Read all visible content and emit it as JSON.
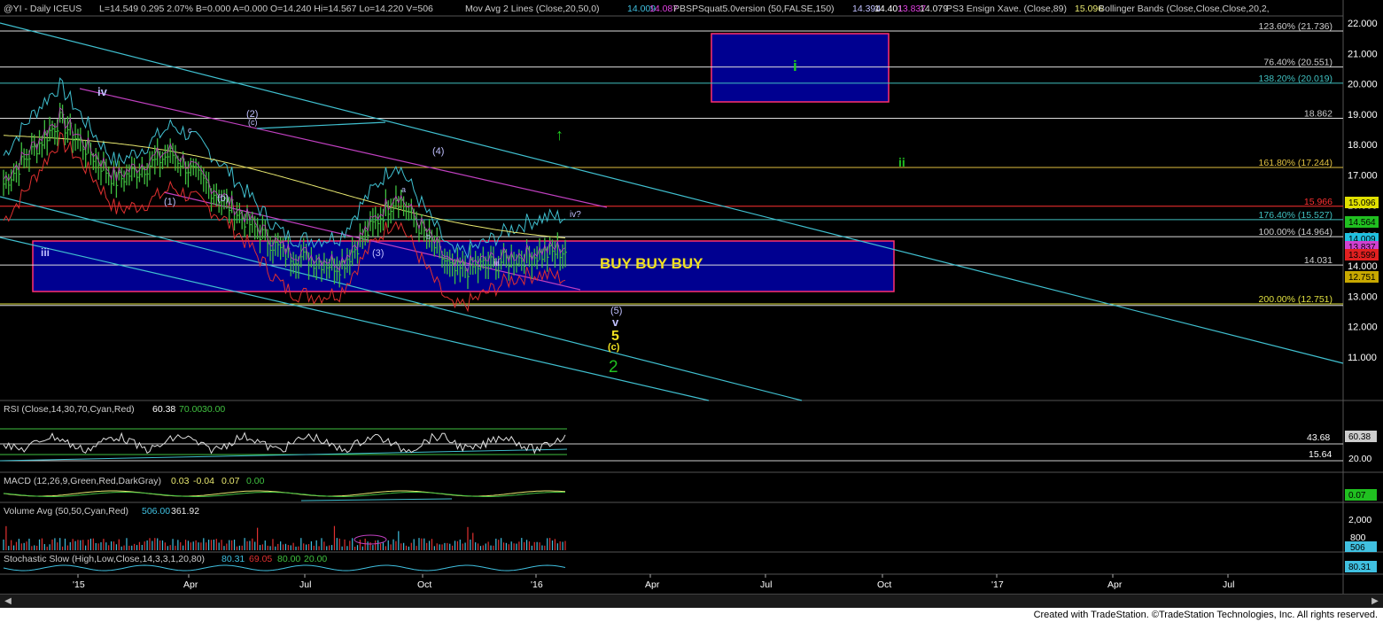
{
  "header": {
    "symbol": "@YI - Daily  ICEUS",
    "quote": "L=14.549  0.295  2.07%  B=0.000   A=0.000   O=14.240  Hi=14.567  Lo=14.220  V=506",
    "ma_label": "Mov Avg 2 Lines (Close,20,50,0)",
    "ma_vals": [
      "14.009",
      "14.087"
    ],
    "squat_label": "PBSPSquat5.0version (50,FALSE,150)",
    "squat_vals": [
      "14.394",
      "14.401",
      "13.837",
      "14.079"
    ],
    "ens_label": "PS3 Ensign Xave. (Close,89)",
    "ens_val": "15.096",
    "bb_label": "Bollinger Bands (Close,Close,Close,20,2,"
  },
  "price_axis": [
    "22.000",
    "21.000",
    "20.000",
    "19.000",
    "18.000",
    "17.000",
    "16.000",
    "15.000",
    "14.000",
    "13.000",
    "12.000",
    "11.000"
  ],
  "price_levels": [
    {
      "label": "123.60% (21.736)",
      "value": 21.736,
      "color": "#cccccc"
    },
    {
      "label": "76.40% (20.551)",
      "value": 20.551,
      "color": "#cccccc"
    },
    {
      "label": "138.20% (20.019)",
      "value": 20.019,
      "color": "#40c0c0"
    },
    {
      "label": "18.862",
      "value": 18.862,
      "color": "#cccccc"
    },
    {
      "label": "161.80% (17.244)",
      "value": 17.244,
      "color": "#e0c040"
    },
    {
      "label": "15.966",
      "value": 15.966,
      "color": "#ff3030"
    },
    {
      "label": "176.40% (15.527)",
      "value": 15.527,
      "color": "#40c0c0"
    },
    {
      "label": "100.00% (14.964)",
      "value": 14.964,
      "color": "#cccccc"
    },
    {
      "label": "14.031",
      "value": 14.031,
      "color": "#cccccc"
    },
    {
      "label": "200.00% (12.751)",
      "value": 12.751,
      "color": "#e0e040"
    }
  ],
  "price_badges": [
    {
      "label": "15.096",
      "bg": "#e0e000",
      "fg": "#000000",
      "y": 232
    },
    {
      "label": "14.564",
      "bg": "#20c020",
      "fg": "#000000",
      "y": 254
    },
    {
      "label": "14.009",
      "bg": "#20c0e0",
      "fg": "#000000",
      "y": 273
    },
    {
      "label": "13.837",
      "bg": "#d040d0",
      "fg": "#000000",
      "y": 282
    },
    {
      "label": "13.599",
      "bg": "#e02020",
      "fg": "#000000",
      "y": 291
    },
    {
      "label": "12.751",
      "bg": "#c8a800",
      "fg": "#000000",
      "y": 316
    }
  ],
  "annotations": {
    "buy_text": "BUY BUY BUY",
    "green_i": "i",
    "green_ii": "ii",
    "arrow": "↑",
    "wave_iv_left": "iv",
    "wave_2_paren": "(2)",
    "wave_1_paren": "(1)",
    "wave_b_paren": "(b)",
    "wave_c_paren": "(c)",
    "wave_3_paren": "(3)",
    "wave_4_paren": "(4)",
    "wave_iii_left": "iii",
    "wave_iii_mid": "iii",
    "wave_iv_q": "iv?",
    "wave_a": "a",
    "wave_b": "b",
    "wave_b2": "b",
    "wave_c": "c",
    "wave_5_paren": "(5)",
    "wave_v": "v",
    "wave_5": "5",
    "wave_c_yellow": "(c)",
    "wave_2_green": "2"
  },
  "rsi": {
    "label": "RSI (Close,14,30,70,Cyan,Red)",
    "val": "60.38",
    "ob": "70.00",
    "os": "30.00",
    "axis": [
      "43.68",
      "15.64"
    ],
    "badge": "60.38",
    "axis_right": "20.00"
  },
  "macd": {
    "label": "MACD (12,26,9,Green,Red,DarkGray)",
    "vals": [
      "0.03",
      "-0.04",
      "0.07",
      "0.00"
    ],
    "badge": "0.07"
  },
  "volume": {
    "label": "Volume Avg (50,50,Cyan,Red)",
    "vals": [
      "506.00",
      "361.92"
    ],
    "axis": [
      "2,000",
      "800"
    ],
    "badge": "506"
  },
  "stoch": {
    "label": "Stochastic Slow (High,Low,Close,14,3,3,1,20,80)",
    "vals": [
      "80.31",
      "69.05",
      "80.00",
      "20.00"
    ],
    "badge": "80.31"
  },
  "x_axis": [
    "'15",
    "Apr",
    "Jul",
    "Oct",
    "'16",
    "Apr",
    "Jul",
    "Oct",
    "'17",
    "Apr",
    "Jul"
  ],
  "footer": "Created with TradeStation. ©TradeStation Technologies, Inc. All rights reserved.",
  "colors": {
    "cyan": "#40c0d0",
    "magenta": "#c040c0",
    "yellow": "#e8e870",
    "red": "#e03030",
    "green": "#40c040",
    "navy": "#000090",
    "box_border": "#ff3070"
  },
  "chart_data": {
    "type": "line",
    "title": "@YI - Daily  ICEUS",
    "xlabel": "",
    "ylabel": "",
    "ylim": [
      10.3,
      22.4
    ],
    "x": [
      "'15",
      "Apr",
      "Jul",
      "Oct",
      "'16"
    ],
    "series": [
      {
        "values": [
          16.7,
          18.8,
          16.8,
          17.7,
          16.0,
          14.4,
          14.0,
          16.3,
          13.8,
          14.2,
          14.5
        ]
      }
    ]
  }
}
